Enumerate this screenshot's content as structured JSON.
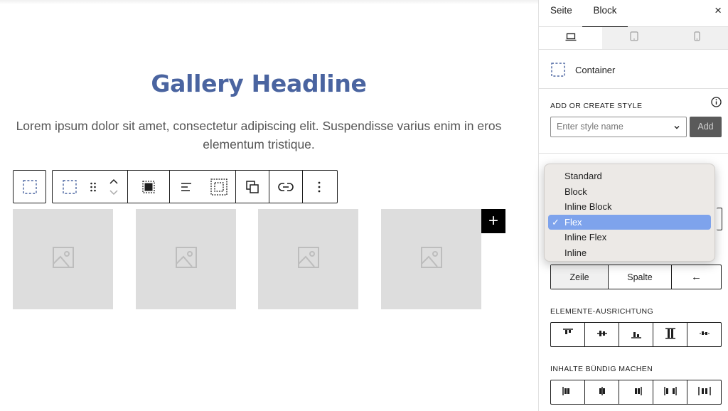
{
  "canvas": {
    "headline": "Gallery Headline",
    "paragraph": "Lorem ipsum dolor sit amet, consectetur adipiscing elit. Suspendisse varius enim in eros elementum tristique.",
    "add_symbol": "+"
  },
  "toolbar": {
    "icons": [
      "container-icon",
      "select-parent-icon",
      "drag-handle-icon",
      "move-up-down-icon",
      "full-size-icon",
      "align-left-icon",
      "padding-icon",
      "duplicate-icon",
      "link-icon",
      "more-options-icon"
    ]
  },
  "gallery": {
    "tiles": [
      "image-placeholder",
      "image-placeholder",
      "image-placeholder",
      "image-placeholder"
    ]
  },
  "sidebar": {
    "tabs": {
      "page": "Seite",
      "block": "Block"
    },
    "close_symbol": "×",
    "devices": [
      "desktop",
      "tablet",
      "mobile"
    ],
    "block_name": "Container",
    "style": {
      "label": "ADD OR CREATE STYLE",
      "placeholder": "Enter style name",
      "add_label": "Add"
    },
    "direction": {
      "options": [
        "Zeile",
        "Spalte",
        "←"
      ],
      "selected": "Zeile"
    },
    "align_items": {
      "label": "ELEMENTE-AUSRICHTUNG"
    },
    "justify_content": {
      "label": "INHALTE BÜNDIG MACHEN"
    }
  },
  "display_dropdown": {
    "options": [
      "Standard",
      "Block",
      "Inline Block",
      "Flex",
      "Inline Flex",
      "Inline"
    ],
    "selected": "Flex",
    "check_symbol": "✓"
  },
  "colors": {
    "headline": "#4a64a0",
    "selected_option": "#7ea3ec",
    "add_button": "#5a5a5a",
    "placeholder_tile": "#dddddd"
  }
}
